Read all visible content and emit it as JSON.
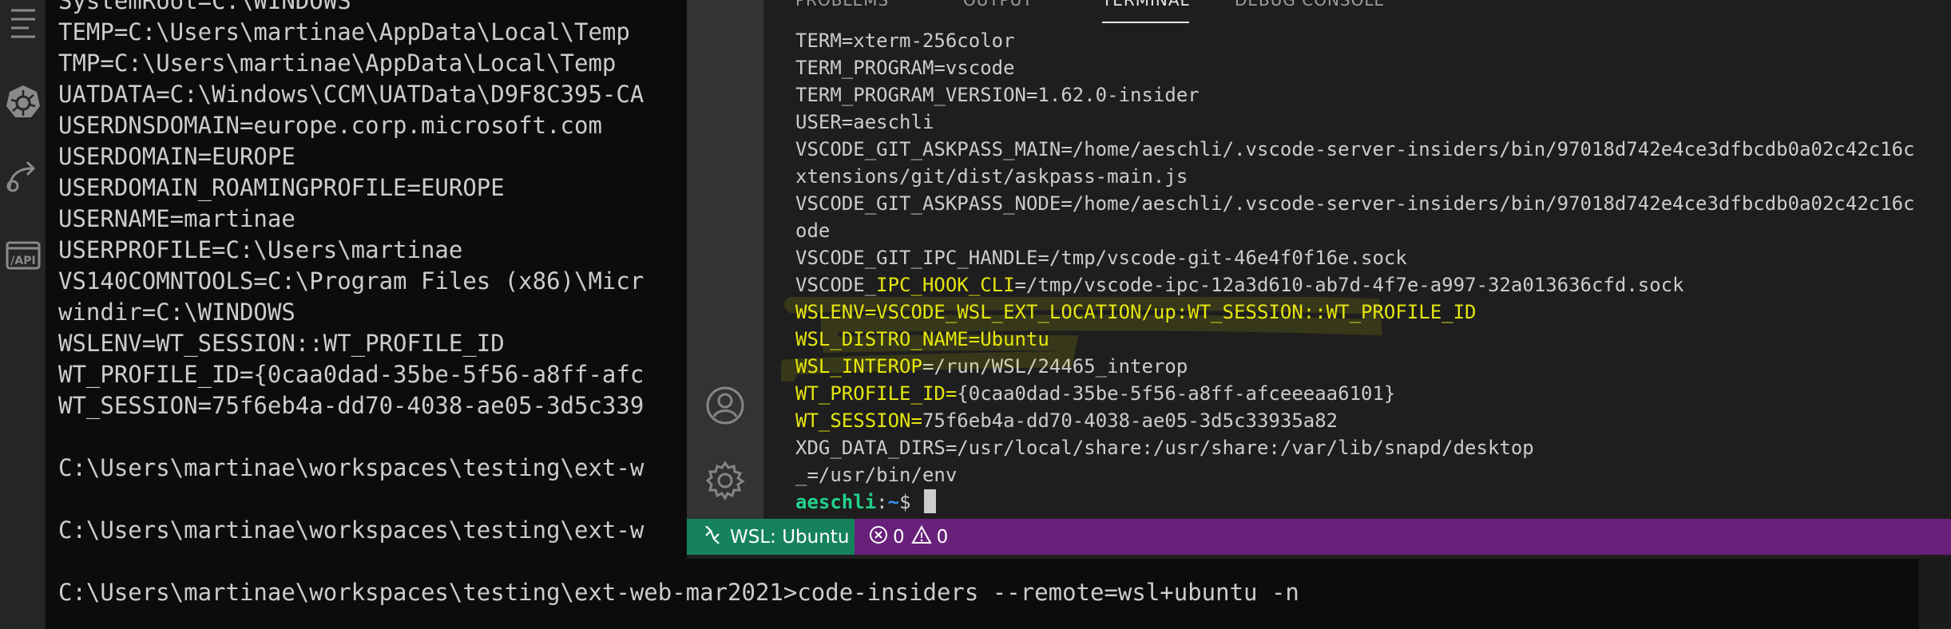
{
  "background_terminal": {
    "lines": [
      "SystemRoot=C:\\WINDOWS",
      "TEMP=C:\\Users\\martinae\\AppData\\Local\\Temp",
      "TMP=C:\\Users\\martinae\\AppData\\Local\\Temp",
      "UATDATA=C:\\Windows\\CCM\\UATData\\D9F8C395-CA",
      "USERDNSDOMAIN=europe.corp.microsoft.com",
      "USERDOMAIN=EUROPE",
      "USERDOMAIN_ROAMINGPROFILE=EUROPE",
      "USERNAME=martinae",
      "USERPROFILE=C:\\Users\\martinae",
      "VS140COMNTOOLS=C:\\Program Files (x86)\\Micr",
      "windir=C:\\WINDOWS",
      "WSLENV=WT_SESSION::WT_PROFILE_ID",
      "WT_PROFILE_ID={0caa0dad-35be-5f56-a8ff-afc",
      "WT_SESSION=75f6eb4a-dd70-4038-ae05-3d5c339",
      "",
      "C:\\Users\\martinae\\workspaces\\testing\\ext-w",
      "",
      "C:\\Users\\martinae\\workspaces\\testing\\ext-w",
      "",
      "C:\\Users\\martinae\\workspaces\\testing\\ext-web-mar2021>code-insiders --remote=wsl+ubuntu -n"
    ]
  },
  "left_strip": {
    "icons": [
      "menu-lines-icon",
      "kubernetes-icon",
      "remote-explorer-icon",
      "api-icon"
    ],
    "api_label": "/API"
  },
  "vscode": {
    "activity_icons": [
      "accounts-icon",
      "manage-gear-icon"
    ],
    "panel_tabs": [
      {
        "label": "PROBLEMS",
        "active": false
      },
      {
        "label": "OUTPUT",
        "active": false
      },
      {
        "label": "TERMINAL",
        "active": true
      },
      {
        "label": "DEBUG CONSOLE",
        "active": false
      }
    ],
    "terminal_lines": [
      {
        "key": "",
        "value": "TERM=xterm-256color"
      },
      {
        "key": "",
        "value": "TERM_PROGRAM=vscode"
      },
      {
        "key": "",
        "value": "TERM_PROGRAM_VERSION=1.62.0-insider"
      },
      {
        "key": "",
        "value": "USER=aeschli"
      },
      {
        "key": "",
        "value": "VSCODE_GIT_ASKPASS_MAIN=/home/aeschli/.vscode-server-insiders/bin/97018d742e4ce3dfbcdb0a02c42c16c"
      },
      {
        "key": "",
        "value": "xtensions/git/dist/askpass-main.js"
      },
      {
        "key": "",
        "value": "VSCODE_GIT_ASKPASS_NODE=/home/aeschli/.vscode-server-insiders/bin/97018d742e4ce3dfbcdb0a02c42c16c"
      },
      {
        "key": "",
        "value": "ode"
      },
      {
        "key": "",
        "value": "VSCODE_GIT_IPC_HANDLE=/tmp/vscode-git-46e4f0f16e.sock"
      },
      {
        "key": "VSCODE_",
        "key_hl": "IPC_HOOK_CLI",
        "value": "=/tmp/vscode-ipc-12a3d610-ab7d-4f7e-a997-32a013636cfd.sock"
      },
      {
        "key_hl": "WSLENV=VSCODE_WSL_EXT_LOCATION/up:WT_SESSION::WT_PROFILE_ID",
        "value": ""
      },
      {
        "key_hl": "WSL_DISTRO_NAME=Ubuntu",
        "value": ""
      },
      {
        "key_hl": "WSL_INTEROP",
        "value": "=/run/WSL/24465_interop"
      },
      {
        "key_hl": "WT_PROFILE_ID=",
        "value": "{0caa0dad-35be-5f56-a8ff-afceeeaa6101}"
      },
      {
        "key_hl": "WT_SESSION=",
        "value": "75f6eb4a-dd70-4038-ae05-3d5c33935a82"
      },
      {
        "key": "",
        "value": "XDG_DATA_DIRS=/usr/local/share:/usr/share:/var/lib/snapd/desktop"
      },
      {
        "key": "",
        "value": "_=/usr/bin/env"
      }
    ],
    "prompt": {
      "user": "aeschli",
      "sep": ":",
      "path": "~",
      "symbol": "$ "
    },
    "statusbar": {
      "remote_label": "WSL: Ubuntu",
      "errors": "0",
      "warnings": "0"
    },
    "colors": {
      "statusbar": "#68217a",
      "remote": "#16825d",
      "highlight": "#e5e510"
    }
  }
}
